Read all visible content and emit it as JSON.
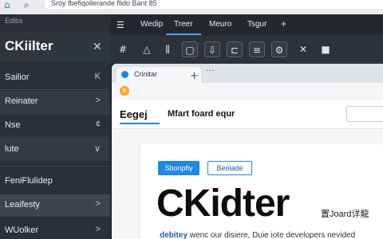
{
  "browser": {
    "url": "Sroy fbefiqollerande flido Bant 85"
  },
  "sidebar": {
    "header": "Edibs",
    "title": "CKiilter",
    "items": [
      {
        "label": "Sailior",
        "chevron": "K"
      },
      {
        "label": "Reinater",
        "chevron": ">"
      },
      {
        "label": "Nse",
        "chevron": "¢"
      },
      {
        "label": "lute",
        "chevron": "∨"
      },
      {
        "label": "FeniFlulidep",
        "chevron": ""
      },
      {
        "label": "Leaifesty",
        "chevron": ">"
      },
      {
        "label": "WUolker",
        "chevron": ">"
      }
    ]
  },
  "menubar": {
    "items": [
      "Wedip",
      "Treer",
      "Meuro",
      "Tsgur",
      "+"
    ]
  },
  "panel": {
    "tab_name": "Crinitar",
    "page_logo": "Eegej",
    "page_crumb": "Mfart foard equr",
    "badge_primary": "Sbonpfiy",
    "badge_secondary": "Beolade",
    "hero": "CKidter",
    "hero_side": "置Joard详龍",
    "tagline_link": "debitey",
    "tagline_rest": "wenc our disiere, Duie iote developers nevided"
  },
  "colors": {
    "accent": "#1e88e5",
    "sidebar_bg": "#2b3038",
    "menubar_bg": "#24282e"
  }
}
